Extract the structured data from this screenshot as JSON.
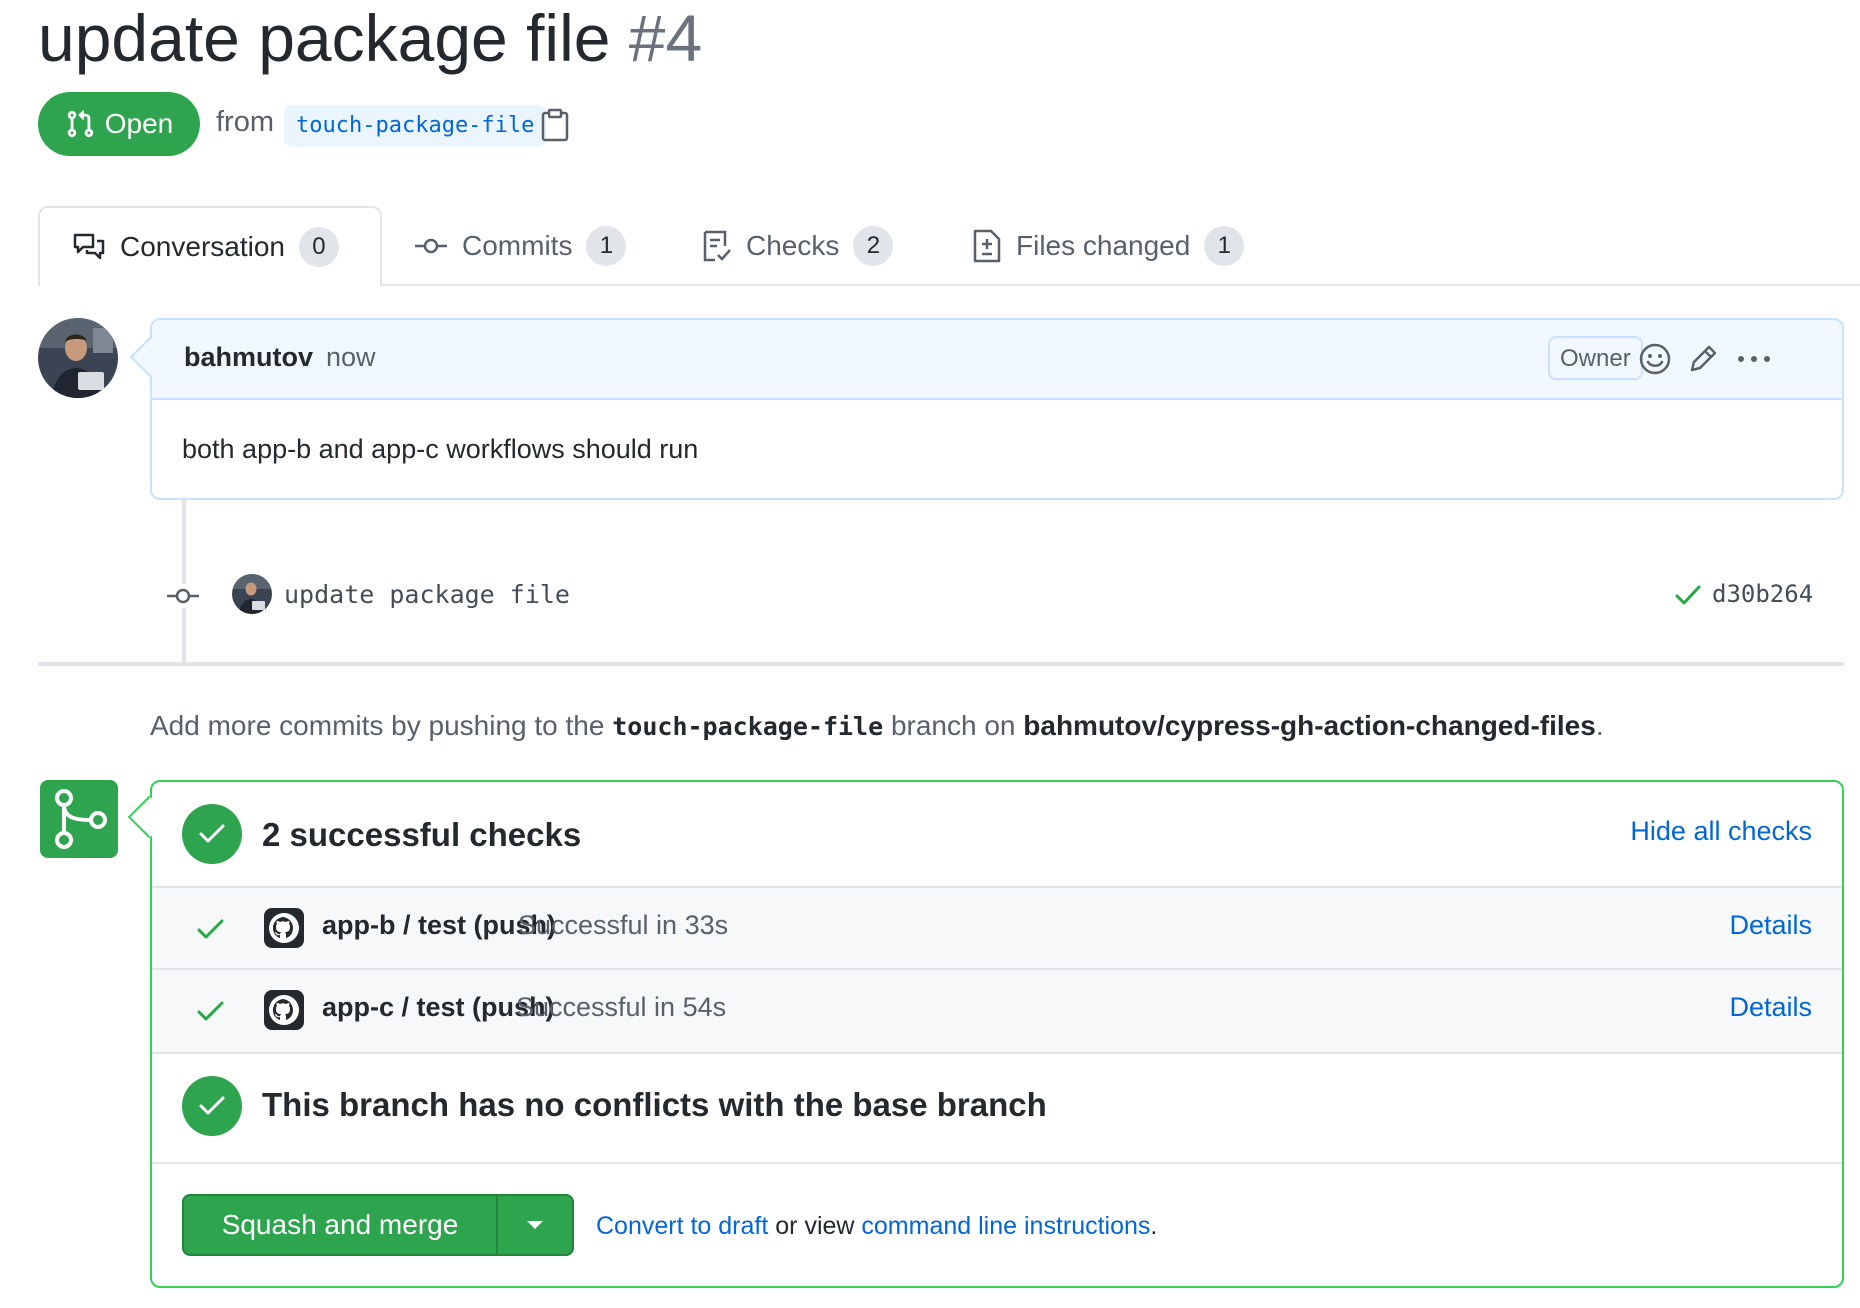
{
  "pr": {
    "title": "update package file",
    "number": "#4",
    "state": "Open",
    "from_label": "from",
    "branch": "touch-package-file"
  },
  "tabs": [
    {
      "label": "Conversation",
      "count": "0",
      "icon": "comment-discussion-icon"
    },
    {
      "label": "Commits",
      "count": "1",
      "icon": "git-commit-icon"
    },
    {
      "label": "Checks",
      "count": "2",
      "icon": "checklist-icon"
    },
    {
      "label": "Files changed",
      "count": "1",
      "icon": "file-diff-icon"
    }
  ],
  "comment": {
    "author": "bahmutov",
    "time": "now",
    "role_badge": "Owner",
    "body": "both app-b and app-c workflows should run"
  },
  "commit": {
    "message": "update package file",
    "sha": "d30b264"
  },
  "push_hint": {
    "prefix": "Add more commits by pushing to the",
    "branch": "touch-package-file",
    "middle": "branch on",
    "repo": "bahmutov/cypress-gh-action-changed-files",
    "suffix": "."
  },
  "checks": {
    "title": "2 successful checks",
    "toggle_label": "Hide all checks",
    "items": [
      {
        "name": "app-b / test (push)",
        "status": "Successful in 33s",
        "details": "Details"
      },
      {
        "name": "app-c / test (push)",
        "status": "Successful in 54s",
        "details": "Details"
      }
    ]
  },
  "merge": {
    "conflict_text": "This branch has no conflicts with the base branch",
    "button_label": "Squash and merge",
    "convert_draft": "Convert to draft",
    "or_view": "or view",
    "cli_link": "command line instructions",
    "period": "."
  },
  "colors": {
    "success": "#2ea44f",
    "link": "#0366d6",
    "muted": "#586069"
  }
}
